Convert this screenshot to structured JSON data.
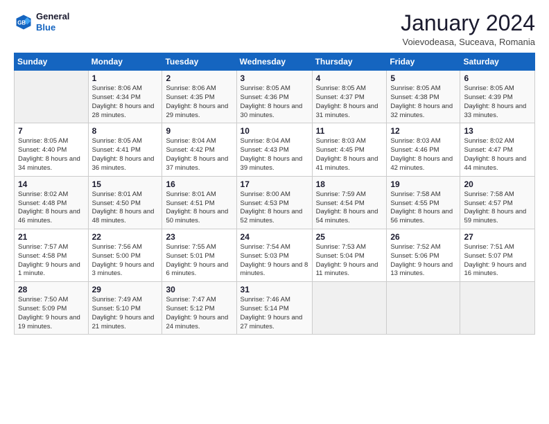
{
  "logo": {
    "line1": "General",
    "line2": "Blue"
  },
  "title": "January 2024",
  "subtitle": "Voievodeasa, Suceava, Romania",
  "weekdays": [
    "Sunday",
    "Monday",
    "Tuesday",
    "Wednesday",
    "Thursday",
    "Friday",
    "Saturday"
  ],
  "weeks": [
    [
      {
        "day": "",
        "info": ""
      },
      {
        "day": "1",
        "info": "Sunrise: 8:06 AM\nSunset: 4:34 PM\nDaylight: 8 hours\nand 28 minutes."
      },
      {
        "day": "2",
        "info": "Sunrise: 8:06 AM\nSunset: 4:35 PM\nDaylight: 8 hours\nand 29 minutes."
      },
      {
        "day": "3",
        "info": "Sunrise: 8:05 AM\nSunset: 4:36 PM\nDaylight: 8 hours\nand 30 minutes."
      },
      {
        "day": "4",
        "info": "Sunrise: 8:05 AM\nSunset: 4:37 PM\nDaylight: 8 hours\nand 31 minutes."
      },
      {
        "day": "5",
        "info": "Sunrise: 8:05 AM\nSunset: 4:38 PM\nDaylight: 8 hours\nand 32 minutes."
      },
      {
        "day": "6",
        "info": "Sunrise: 8:05 AM\nSunset: 4:39 PM\nDaylight: 8 hours\nand 33 minutes."
      }
    ],
    [
      {
        "day": "7",
        "info": "Sunrise: 8:05 AM\nSunset: 4:40 PM\nDaylight: 8 hours\nand 34 minutes."
      },
      {
        "day": "8",
        "info": "Sunrise: 8:05 AM\nSunset: 4:41 PM\nDaylight: 8 hours\nand 36 minutes."
      },
      {
        "day": "9",
        "info": "Sunrise: 8:04 AM\nSunset: 4:42 PM\nDaylight: 8 hours\nand 37 minutes."
      },
      {
        "day": "10",
        "info": "Sunrise: 8:04 AM\nSunset: 4:43 PM\nDaylight: 8 hours\nand 39 minutes."
      },
      {
        "day": "11",
        "info": "Sunrise: 8:03 AM\nSunset: 4:45 PM\nDaylight: 8 hours\nand 41 minutes."
      },
      {
        "day": "12",
        "info": "Sunrise: 8:03 AM\nSunset: 4:46 PM\nDaylight: 8 hours\nand 42 minutes."
      },
      {
        "day": "13",
        "info": "Sunrise: 8:02 AM\nSunset: 4:47 PM\nDaylight: 8 hours\nand 44 minutes."
      }
    ],
    [
      {
        "day": "14",
        "info": "Sunrise: 8:02 AM\nSunset: 4:48 PM\nDaylight: 8 hours\nand 46 minutes."
      },
      {
        "day": "15",
        "info": "Sunrise: 8:01 AM\nSunset: 4:50 PM\nDaylight: 8 hours\nand 48 minutes."
      },
      {
        "day": "16",
        "info": "Sunrise: 8:01 AM\nSunset: 4:51 PM\nDaylight: 8 hours\nand 50 minutes."
      },
      {
        "day": "17",
        "info": "Sunrise: 8:00 AM\nSunset: 4:53 PM\nDaylight: 8 hours\nand 52 minutes."
      },
      {
        "day": "18",
        "info": "Sunrise: 7:59 AM\nSunset: 4:54 PM\nDaylight: 8 hours\nand 54 minutes."
      },
      {
        "day": "19",
        "info": "Sunrise: 7:58 AM\nSunset: 4:55 PM\nDaylight: 8 hours\nand 56 minutes."
      },
      {
        "day": "20",
        "info": "Sunrise: 7:58 AM\nSunset: 4:57 PM\nDaylight: 8 hours\nand 59 minutes."
      }
    ],
    [
      {
        "day": "21",
        "info": "Sunrise: 7:57 AM\nSunset: 4:58 PM\nDaylight: 9 hours\nand 1 minute."
      },
      {
        "day": "22",
        "info": "Sunrise: 7:56 AM\nSunset: 5:00 PM\nDaylight: 9 hours\nand 3 minutes."
      },
      {
        "day": "23",
        "info": "Sunrise: 7:55 AM\nSunset: 5:01 PM\nDaylight: 9 hours\nand 6 minutes."
      },
      {
        "day": "24",
        "info": "Sunrise: 7:54 AM\nSunset: 5:03 PM\nDaylight: 9 hours\nand 8 minutes."
      },
      {
        "day": "25",
        "info": "Sunrise: 7:53 AM\nSunset: 5:04 PM\nDaylight: 9 hours\nand 11 minutes."
      },
      {
        "day": "26",
        "info": "Sunrise: 7:52 AM\nSunset: 5:06 PM\nDaylight: 9 hours\nand 13 minutes."
      },
      {
        "day": "27",
        "info": "Sunrise: 7:51 AM\nSunset: 5:07 PM\nDaylight: 9 hours\nand 16 minutes."
      }
    ],
    [
      {
        "day": "28",
        "info": "Sunrise: 7:50 AM\nSunset: 5:09 PM\nDaylight: 9 hours\nand 19 minutes."
      },
      {
        "day": "29",
        "info": "Sunrise: 7:49 AM\nSunset: 5:10 PM\nDaylight: 9 hours\nand 21 minutes."
      },
      {
        "day": "30",
        "info": "Sunrise: 7:47 AM\nSunset: 5:12 PM\nDaylight: 9 hours\nand 24 minutes."
      },
      {
        "day": "31",
        "info": "Sunrise: 7:46 AM\nSunset: 5:14 PM\nDaylight: 9 hours\nand 27 minutes."
      },
      {
        "day": "",
        "info": ""
      },
      {
        "day": "",
        "info": ""
      },
      {
        "day": "",
        "info": ""
      }
    ]
  ]
}
